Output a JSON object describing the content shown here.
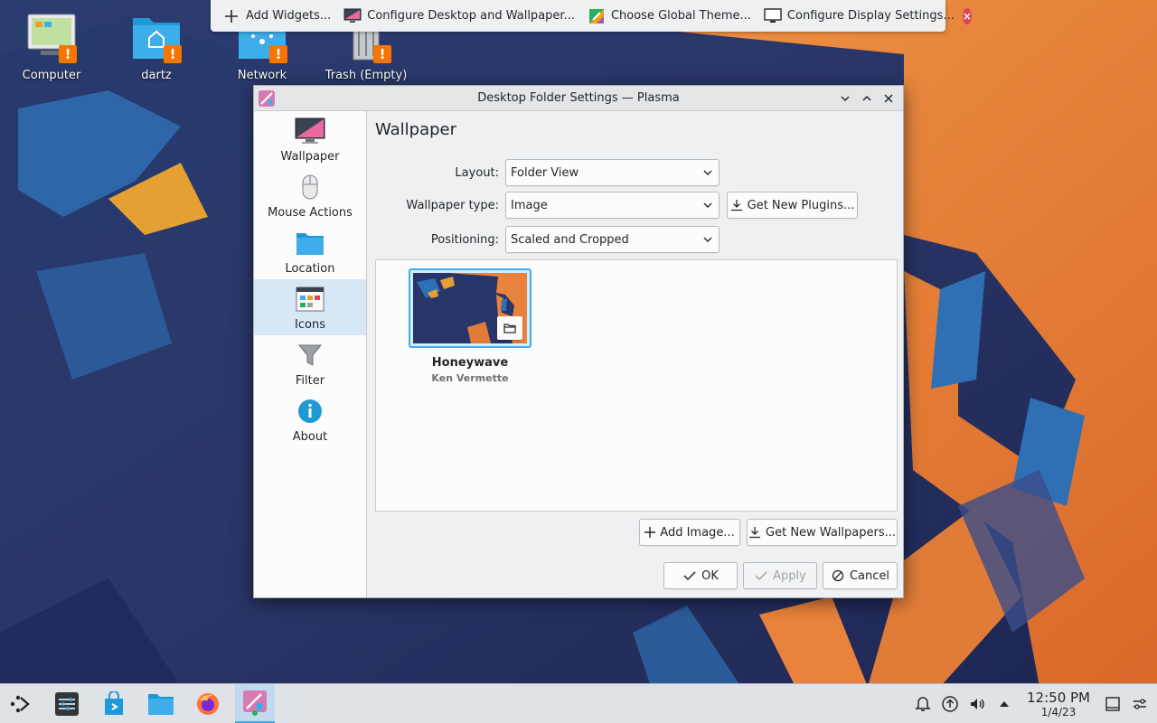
{
  "toolbox": {
    "items": [
      {
        "label": "Add Widgets...",
        "icon": "plus-icon"
      },
      {
        "label": "Configure Desktop and Wallpaper...",
        "icon": "desktop-monitor-icon"
      },
      {
        "label": "Choose Global Theme...",
        "icon": "theme-icon"
      },
      {
        "label": "Configure Display Settings...",
        "icon": "display-icon"
      }
    ],
    "close_icon": "close-icon"
  },
  "desktop": {
    "icons": [
      {
        "label": "Computer",
        "icon": "computer-icon"
      },
      {
        "label": "dartz",
        "icon": "home-folder-icon"
      },
      {
        "label": "Network",
        "icon": "network-folder-icon"
      },
      {
        "label": "Trash (Empty)",
        "icon": "trash-icon"
      }
    ],
    "warning_glyph": "!"
  },
  "dialog": {
    "title": "Desktop Folder Settings — Plasma",
    "sidebar": [
      {
        "label": "Wallpaper",
        "icon": "monitor-icon",
        "active": false
      },
      {
        "label": "Mouse Actions",
        "icon": "mouse-icon",
        "active": false
      },
      {
        "label": "Location",
        "icon": "folder-icon",
        "active": false
      },
      {
        "label": "Icons",
        "icon": "icons-view-icon",
        "active": true
      },
      {
        "label": "Filter",
        "icon": "filter-icon",
        "active": false
      },
      {
        "label": "About",
        "icon": "info-icon",
        "active": false
      }
    ],
    "page_title": "Wallpaper",
    "layout": {
      "label": "Layout:",
      "value": "Folder View"
    },
    "wallpaper_type": {
      "label": "Wallpaper type:",
      "value": "Image"
    },
    "get_new_plugins": "Get New Plugins...",
    "positioning": {
      "label": "Positioning:",
      "value": "Scaled and Cropped"
    },
    "wallpapers": [
      {
        "name": "Honeywave",
        "author": "Ken Vermette"
      }
    ],
    "add_image": "Add Image...",
    "get_new_wallpapers": "Get New Wallpapers...",
    "ok": "OK",
    "apply": "Apply",
    "cancel": "Cancel"
  },
  "taskbar": {
    "apps": [
      "application-launcher-icon",
      "system-settings-icon",
      "discover-store-icon",
      "dolphin-files-icon",
      "firefox-icon",
      "plasma-settings-icon"
    ],
    "clock_time": "12:50 PM",
    "clock_date": "1/4/23"
  },
  "colors": {
    "accent": "#3daee9",
    "warning": "#f67400",
    "close": "#da4453",
    "wallpaper_orange": "#e8823c",
    "wallpaper_blue": "#2f6fb4"
  }
}
